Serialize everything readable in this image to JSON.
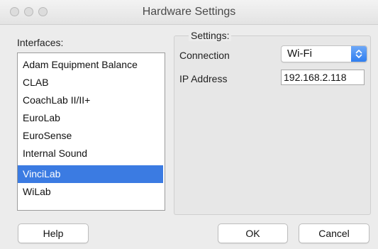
{
  "window": {
    "title": "Hardware Settings",
    "traffic_lights": [
      "close",
      "minimize",
      "zoom"
    ]
  },
  "interfaces": {
    "label": "Interfaces:",
    "items": [
      {
        "label": "Adam Equipment Balance",
        "selected": false
      },
      {
        "label": "CLAB",
        "selected": false
      },
      {
        "label": "CoachLab II/II+",
        "selected": false
      },
      {
        "label": "EuroLab",
        "selected": false
      },
      {
        "label": "EuroSense",
        "selected": false
      },
      {
        "label": "Internal Sound",
        "selected": false
      },
      {
        "label": "VinciLab",
        "selected": true
      },
      {
        "label": "WiLab",
        "selected": false
      }
    ]
  },
  "settings": {
    "title": "Settings:",
    "connection_label": "Connection",
    "connection_value": "Wi-Fi",
    "ip_label": "IP Address",
    "ip_value": "192.168.2.118"
  },
  "buttons": {
    "help": "Help",
    "ok": "OK",
    "cancel": "Cancel"
  },
  "colors": {
    "selection": "#3b7be2",
    "stepper": "#2f7ef0"
  }
}
